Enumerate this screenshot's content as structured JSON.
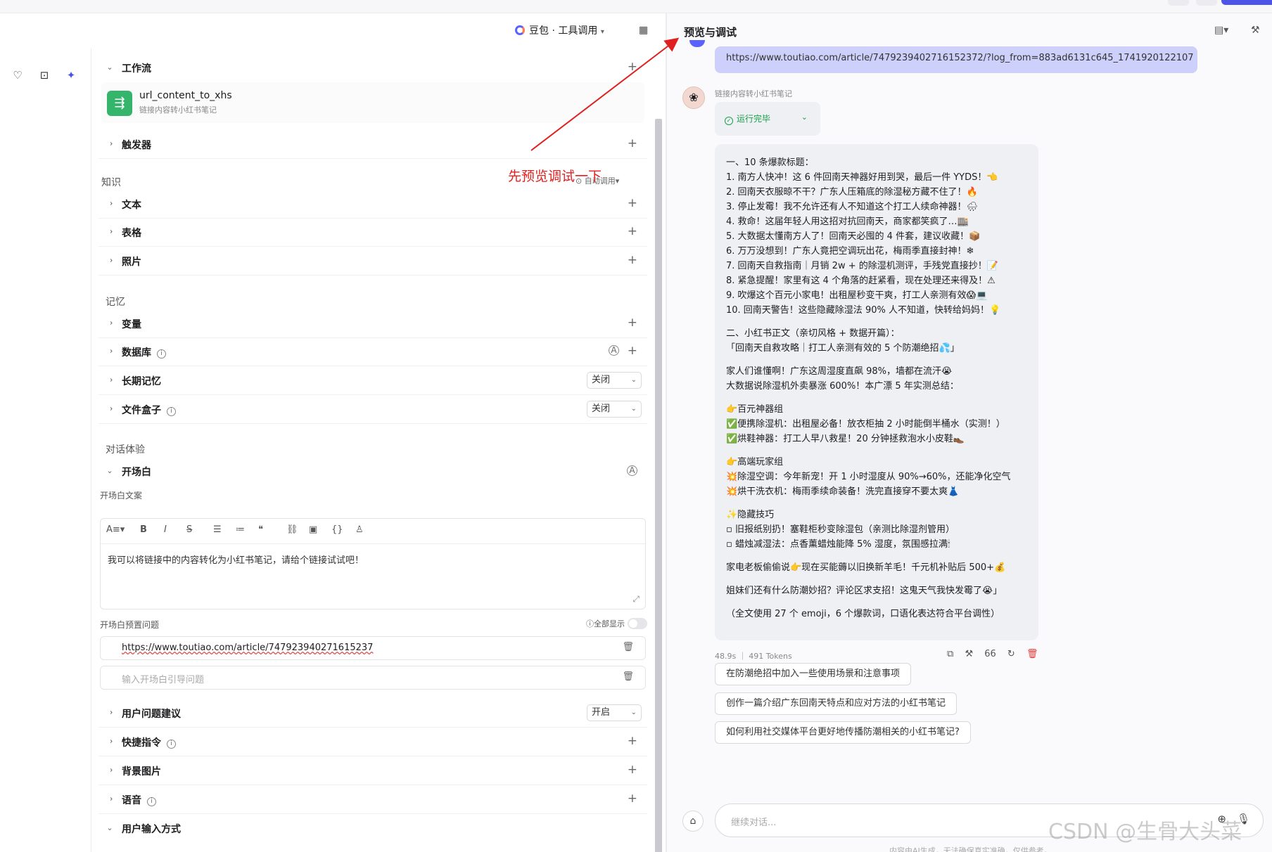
{
  "header": {
    "model_selector": "豆包 · 工具调用",
    "preview_title": "预览与调试"
  },
  "config": {
    "workflow_label": "工作流",
    "workflow_item": {
      "name": "url_content_to_xhs",
      "desc": "链接内容转小红书笔记"
    },
    "trigger_label": "触发器",
    "knowledge_section": "知识",
    "auto_call": "自动调用",
    "text_label": "文本",
    "table_label": "表格",
    "photo_label": "照片",
    "memory_section": "记忆",
    "variable_label": "变量",
    "database_label": "数据库",
    "long_memory_label": "长期记忆",
    "long_memory_value": "关闭",
    "filebox_label": "文件盒子",
    "filebox_value": "关闭",
    "dialog_section": "对话体验",
    "opening_label": "开场白",
    "opening_text_label": "开场白文案",
    "opening_text": "我可以将链接中的内容转化为小红书笔记，请给个链接试试吧！",
    "preset_questions_label": "开场白预置问题",
    "show_all": "全部显示",
    "preset_q1": "https://www.toutiao.com/article/747923940271615237",
    "preset_q_placeholder": "输入开场白引导问题",
    "suggestion_label": "用户问题建议",
    "suggestion_value": "开启",
    "shortcut_label": "快捷指令",
    "background_label": "背景图片",
    "voice_label": "语音",
    "input_method_label": "用户输入方式"
  },
  "preview": {
    "user_url": "https://www.toutiao.com/article/7479239402716152372/?log_from=883ad6131c645_1741920122107",
    "bot_name": "链接内容转小红书笔记",
    "run_status": "运行完毕",
    "answer_lines": [
      "一、10 条爆款标题：",
      "1. 南方人快冲！这 6 件回南天神器好用到哭，最后一件 YYDS！👈",
      "2. 回南天衣服晾不干？广东人压箱底的除湿秘方藏不住了！🔥",
      "3. 停止发霉！我不允许还有人不知道这个打工人续命神器！🌧",
      "4. 救命！这届年轻人用这招对抗回南天，商家都笑疯了…🏬",
      "5. 大数据太懂南方人了！回南天必囤的 4 件套，建议收藏！📦",
      "6. 万万没想到！广东人竟把空调玩出花，梅雨季直接封神！❄",
      "7. 回南天自救指南｜月销 2w + 的除湿机测评，手残党直接抄！📝",
      "8. 紧急提醒！家里有这 4 个角落的赶紧看，现在处理还来得及！⚠",
      "9. 吹爆这个百元小家电！出租屋秒变干爽，打工人亲测有效😱💻",
      "10. 回南天警告！这些隐藏除湿法 90% 人不知道，快转给妈妈！💡",
      "",
      "二、小红书正文（亲切风格 + 数据开篇）：",
      "「回南天自救攻略｜打工人亲测有效的 5 个防潮绝招💦」",
      "",
      "家人们谁懂啊！广东这周湿度直飙 98%，墙都在流汗😭",
      "大数据说除湿机外卖暴涨 600%！本广漂 5 年实测总结：",
      "",
      "👉百元神器组",
      "✅便携除湿机：出租屋必备！放衣柜抽 2 小时能倒半桶水（实测！）",
      "✅烘鞋神器：打工人早八救星！20 分钟拯救泡水小皮鞋👞",
      "",
      "👉高端玩家组",
      "💥除湿空调：今年新宠！开 1 小时湿度从 90%→60%，还能净化空气",
      "💥烘干洗衣机：梅雨季续命装备！洗完直接穿不要太爽👗",
      "",
      "✨隐藏技巧",
      "▫ 旧报纸别扔！塞鞋柜秒变除湿包（亲测比除湿剂管用）",
      "▫ 蜡烛减湿法：点香薰蜡烛能降 5% 湿度，氛围感拉满🕯",
      "",
      "家电老板偷偷说👉现在买能薅以旧换新羊毛！千元机补贴后 500+💰",
      "",
      "姐妹们还有什么防潮妙招？评论区求支招！这鬼天气我快发霉了😭」",
      "",
      "（全文使用 27 个 emoji，6 个爆款词，口语化表达符合平台调性）"
    ],
    "meta": "48.9s ｜ 491 Tokens",
    "quote_count": "66",
    "suggestions": [
      "在防潮绝招中加入一些使用场景和注意事项",
      "创作一篇介绍广东回南天特点和应对方法的小红书笔记",
      "如何利用社交媒体平台更好地传播防潮相关的小红书笔记?"
    ],
    "input_placeholder": "继续对话...",
    "disclaimer": "内容由AI生成，无法确保真实准确，仅供参考。"
  },
  "annotation": "先预览调试一下",
  "watermark": "CSDN @生骨大头菜",
  "colors": {
    "accent": "#4d53e8",
    "annotation": "#e02020",
    "user_bubble": "#cdd0fa",
    "success": "#1a9e4a"
  }
}
